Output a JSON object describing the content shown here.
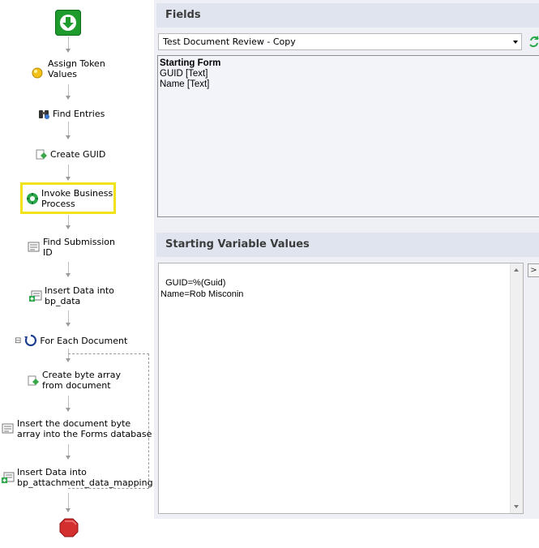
{
  "workflow": {
    "steps": [
      {
        "label_lines": [
          "Assign Token",
          "Values"
        ],
        "icon": "token-coin-icon"
      },
      {
        "label_lines": [
          "Find Entries"
        ],
        "icon": "binoculars-icon"
      },
      {
        "label_lines": [
          "Create GUID"
        ],
        "icon": "script-diamond-icon"
      },
      {
        "label_lines": [
          "Invoke Business",
          "Process"
        ],
        "icon": "gear-invoke-icon"
      },
      {
        "label_lines": [
          "Find Submission",
          "ID"
        ],
        "icon": "query-icon"
      },
      {
        "label_lines": [
          "Insert Data into",
          "bp_data"
        ],
        "icon": "insert-data-icon"
      },
      {
        "label_lines": [
          "For Each Document"
        ],
        "icon": "loop-icon"
      },
      {
        "label_lines": [
          "Create byte array",
          "from document"
        ],
        "icon": "script-diamond-icon"
      },
      {
        "label_lines": [
          "Insert the document byte",
          "array into the Forms database"
        ],
        "icon": "query-icon"
      },
      {
        "label_lines": [
          "Insert Data into",
          "bp_attachment_data_mapping"
        ],
        "icon": "insert-data-icon"
      }
    ],
    "collapse_symbol": "⊟",
    "colors": {
      "start": "#1f9a2c",
      "stop": "#d32f2f",
      "highlight": "#f0e31a"
    }
  },
  "fields_panel": {
    "title": "Fields",
    "selected_process": "Test Document Review - Copy",
    "refresh_icon": "refresh-icon",
    "form_heading": "Starting Form",
    "fields": [
      "GUID [Text]",
      "Name [Text]"
    ]
  },
  "variables_panel": {
    "title": "Starting Variable Values",
    "text": "GUID=%(Guid)\nName=Rob Misconin",
    "side_button": ">"
  }
}
